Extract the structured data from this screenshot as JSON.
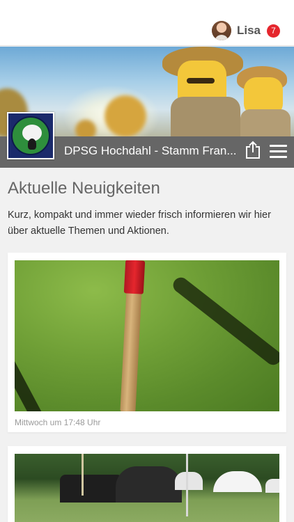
{
  "user": {
    "name": "Lisa",
    "notifications": "7"
  },
  "site": {
    "title": "DPSG Hochdahl - Stamm Fran..."
  },
  "main": {
    "heading": "Aktuelle Neuigkeiten",
    "intro": "Kurz, kompakt und immer wieder frisch informieren wir hier über aktuelle Themen und Aktionen."
  },
  "news": [
    {
      "date": "Mittwoch um 17:48 Uhr"
    },
    {
      "date": ""
    }
  ],
  "colors": {
    "badge": "#e5262d",
    "titlebar": "#5a5a5a",
    "background": "#f1f1f1"
  },
  "icons": {
    "share": "share-icon",
    "menu": "hamburger-menu-icon",
    "avatar": "avatar"
  }
}
